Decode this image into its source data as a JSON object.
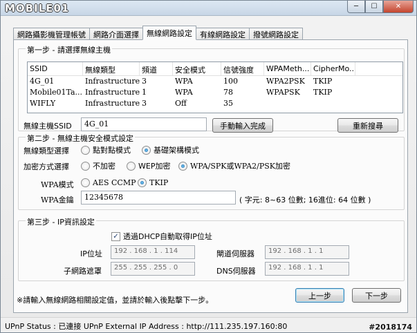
{
  "window": {
    "logo_text": "MOBILE01",
    "controls": {
      "minimize": "─",
      "maximize": "☐",
      "close": "✕"
    }
  },
  "tabs": [
    {
      "label": "網路攝影機管理帳號",
      "active": false
    },
    {
      "label": "網路介面選擇",
      "active": false
    },
    {
      "label": "無線網路設定",
      "active": true
    },
    {
      "label": "有線網路設定",
      "active": false
    },
    {
      "label": "撥號網路設定",
      "active": false
    }
  ],
  "step1": {
    "title": "第一步 - 請選擇無線主機",
    "columns": [
      "SSID",
      "無線類型",
      "頻道",
      "安全模式",
      "信號強度",
      "WPAMeth...",
      "CipherMo..."
    ],
    "rows": [
      [
        "4G_01",
        "Infrastructure",
        "3",
        "WPA",
        "100",
        "WPA2PSK",
        "TKIP"
      ],
      [
        "Mobile01Ta...",
        "Infrastructure",
        "1",
        "WPA",
        "78",
        "WPAPSK",
        "TKIP"
      ],
      [
        "WIFLY",
        "Infrastructure",
        "3",
        "Off",
        "35",
        "",
        ""
      ]
    ],
    "ssid_label": "無線主機SSID",
    "ssid_value": "4G_01",
    "manual_button": "手動輸入完成",
    "rescan_button": "重新搜尋"
  },
  "step2": {
    "title": "第二步 - 無線主機安全模式設定",
    "wireless_type_label": "無線類型選擇",
    "wireless_type_options": [
      {
        "label": "點對點模式",
        "selected": false
      },
      {
        "label": "基礎架構模式",
        "selected": true
      }
    ],
    "encryption_label": "加密方式選擇",
    "encryption_options": [
      {
        "label": "不加密",
        "selected": false
      },
      {
        "label": "WEP加密",
        "selected": false
      },
      {
        "label": "WPA/SPK或WPA2/PSK加密",
        "selected": true
      }
    ],
    "wpa_mode_label": "WPA模式",
    "wpa_mode_options": [
      {
        "label": "AES CCMP",
        "selected": false
      },
      {
        "label": "TKIP",
        "selected": true
      }
    ],
    "wpa_key_label": "WPA金鑰",
    "wpa_key_value": "12345678",
    "wpa_key_hint": "( 字元: 8~63 位數; 16進位: 64 位數 )"
  },
  "step3": {
    "title": "第三步 - IP資訊設定",
    "dhcp_label": "透過DHCP自動取得IP位址",
    "dhcp_checked": true,
    "ip_label": "IP位址",
    "ip_value": "192 . 168 . 1 . 114",
    "gateway_label": "閘道伺服器",
    "gateway_value": "192 . 168 . 1 . 1",
    "subnet_label": "子網路遮罩",
    "subnet_value": "255 . 255 . 255 . 0",
    "dns_label": "DNS伺服器",
    "dns_value": "192 . 168 . 1 . 1"
  },
  "footer": {
    "note": "※請輸入無線網路相關設定值，並請於輸入後點擊下一步。",
    "prev_button": "上一步",
    "next_button": "下一步"
  },
  "statusbar": {
    "text": "UPnP Status :  已連接   UPnP External IP Address :   http://111.235.197.160:80"
  },
  "watermark": "#2018174"
}
